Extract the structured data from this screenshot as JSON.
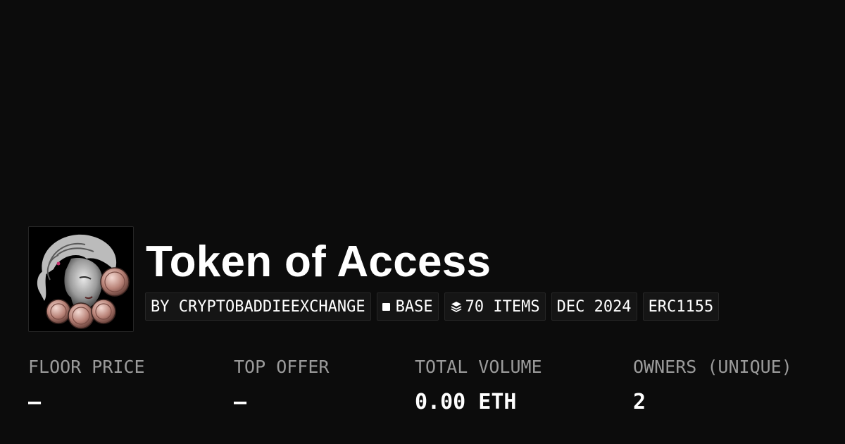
{
  "collection": {
    "name": "Token of Access",
    "tags": {
      "creator": "BY CRYPTOBADDIEEXCHANGE",
      "chain": "BASE",
      "items": "70 ITEMS",
      "date": "DEC 2024",
      "standard": "ERC1155"
    }
  },
  "stats": [
    {
      "label": "FLOOR PRICE",
      "value": "—"
    },
    {
      "label": "TOP OFFER",
      "value": "—"
    },
    {
      "label": "TOTAL VOLUME",
      "value": "0.00 ETH"
    },
    {
      "label": "OWNERS (UNIQUE)",
      "value": "2"
    }
  ],
  "icons": {
    "avatar": "collection-avatar-image",
    "chain": "square-icon",
    "items": "layers-icon"
  },
  "colors": {
    "background": "#0c0c0c",
    "text": "#ffffff",
    "muted": "#9b9b9b",
    "tag_bg": "#151515",
    "tag_border": "#262626"
  }
}
